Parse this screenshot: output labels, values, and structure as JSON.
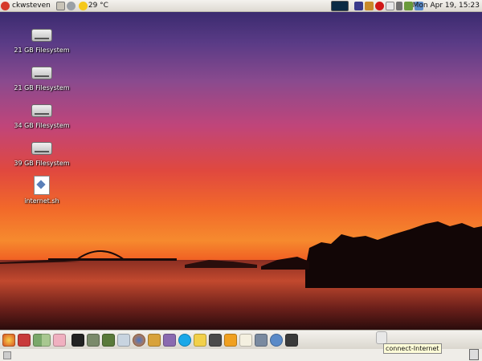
{
  "top_panel": {
    "user": "ckwsteven",
    "weather": "29 °C",
    "clock": "Mon Apr 19, 15:23"
  },
  "desktop_icons": [
    {
      "label": "21 GB Filesystem",
      "kind": "drive"
    },
    {
      "label": "21 GB Filesystem",
      "kind": "drive"
    },
    {
      "label": "34 GB Filesystem",
      "kind": "drive"
    },
    {
      "label": "39 GB Filesystem",
      "kind": "drive"
    },
    {
      "label": "internet.sh",
      "kind": "script"
    }
  ],
  "bottom_panel": {
    "tooltip": "connect-Internet",
    "launchers": [
      "main-menu-icon",
      "show-desktop-icon",
      "workspace-icon",
      "notes-icon",
      "terminal-icon",
      "calculator-icon",
      "dictionary-icon",
      "text-editor-icon",
      "firefox-icon",
      "package-manager-icon",
      "pidgin-icon",
      "skype-icon",
      "mail-icon",
      "system-monitor-icon",
      "compiz-icon",
      "gedit-icon",
      "scanner-icon",
      "network-icon",
      "camera-icon",
      "connect-internet-icon"
    ]
  },
  "colors": {
    "panel": "#e8e5de",
    "accent": "#f0602a"
  }
}
